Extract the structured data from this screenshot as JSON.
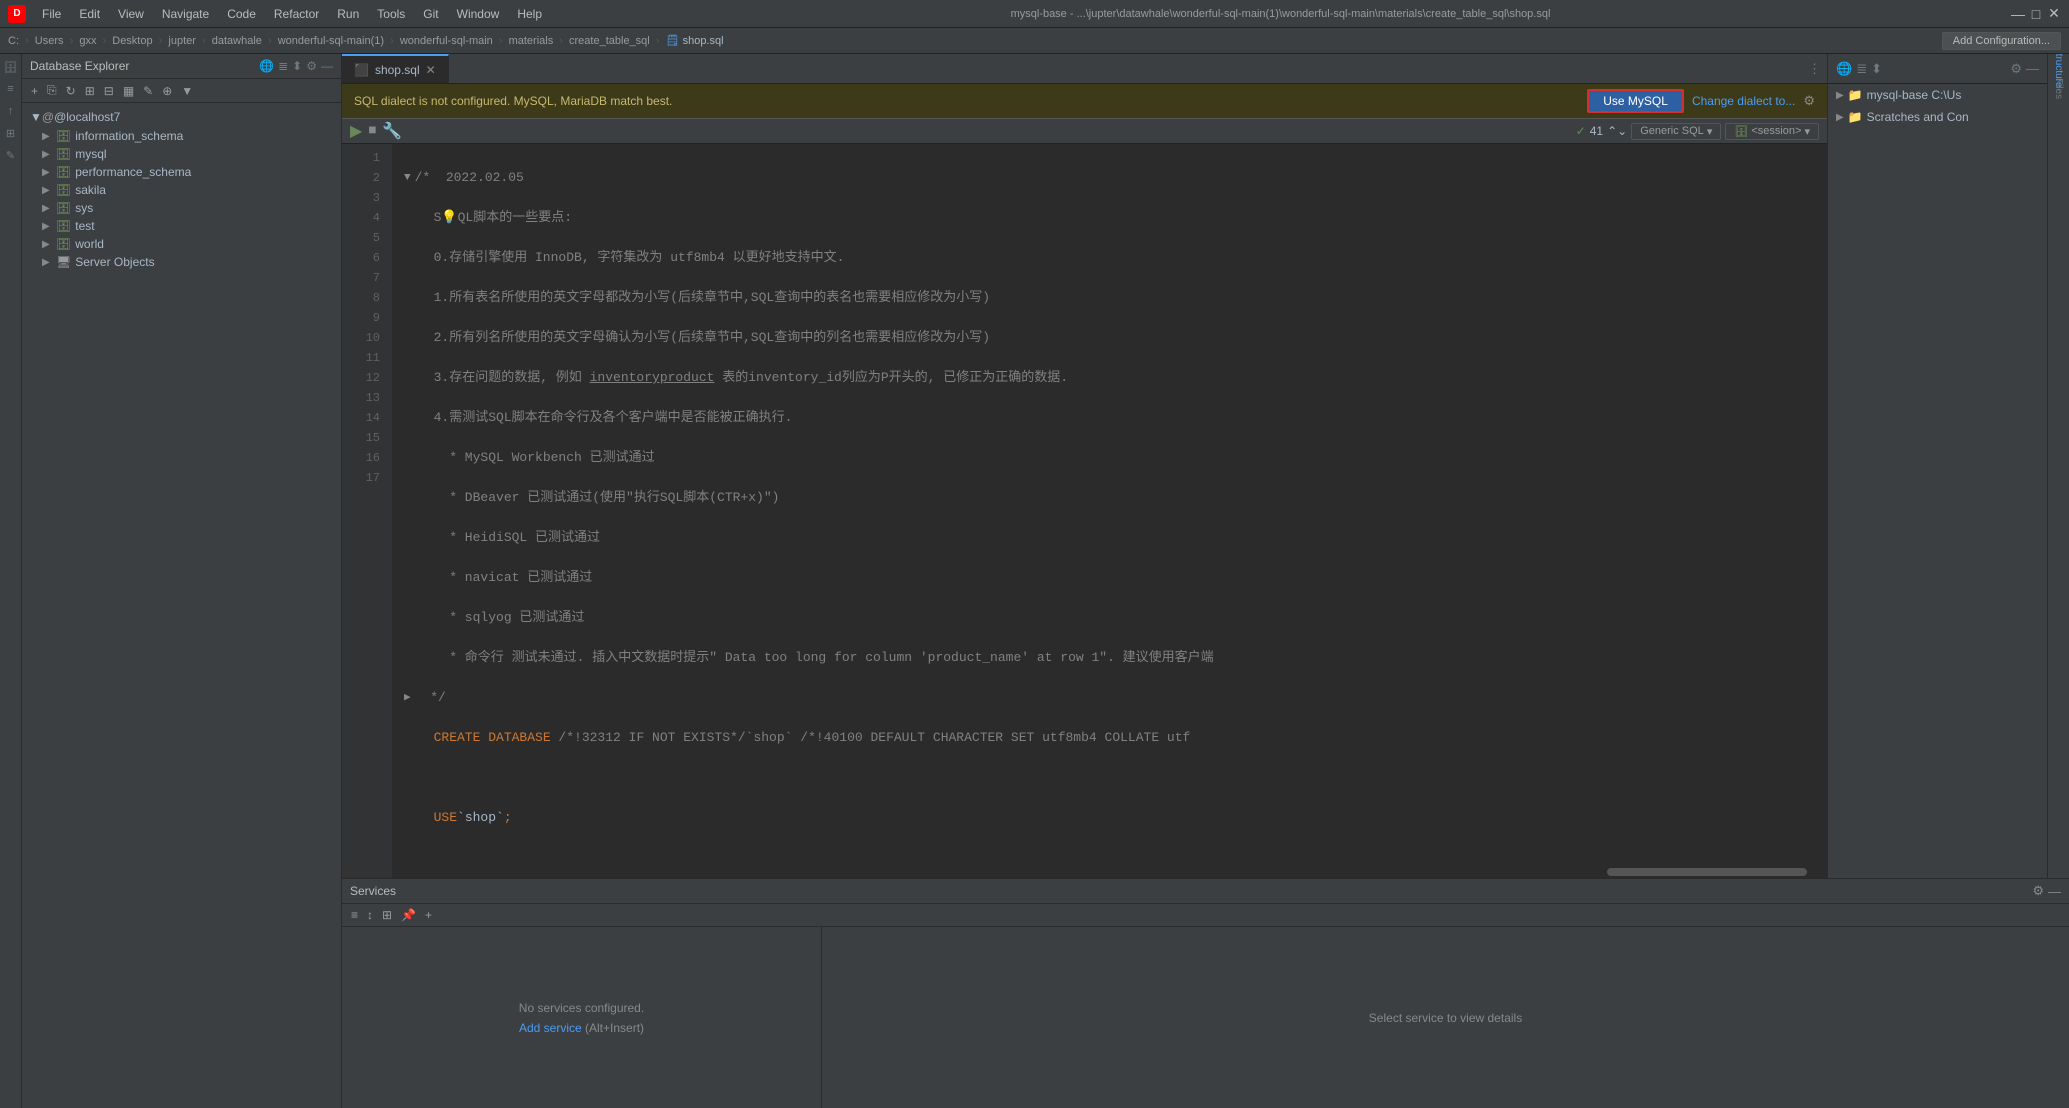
{
  "titlebar": {
    "logo": "D",
    "menus": [
      "File",
      "Edit",
      "View",
      "Navigate",
      "Code",
      "Refactor",
      "Run",
      "Tools",
      "Git",
      "Window",
      "Help"
    ],
    "path": "mysql-base - ...\\jupter\\datawhale\\wonderful-sql-main(1)\\wonderful-sql-main\\materials\\create_table_sql\\shop.sql",
    "controls": [
      "—",
      "□",
      "✕"
    ]
  },
  "breadcrumb": {
    "items": [
      "C:",
      "Users",
      "gxx",
      "Desktop",
      "jupter",
      "datawhale",
      "wonderful-sql-main(1)",
      "wonderful-sql-main",
      "materials",
      "create_table_sql"
    ],
    "file": "shop.sql",
    "add_config": "Add Configuration..."
  },
  "db_explorer": {
    "title": "Database Explorer",
    "root": "@localhost",
    "badge": "7",
    "items": [
      {
        "name": "information_schema",
        "type": "schema",
        "expanded": false
      },
      {
        "name": "mysql",
        "type": "schema",
        "expanded": false
      },
      {
        "name": "performance_schema",
        "type": "schema",
        "expanded": false
      },
      {
        "name": "sakila",
        "type": "schema",
        "expanded": false
      },
      {
        "name": "sys",
        "type": "schema",
        "expanded": false
      },
      {
        "name": "test",
        "type": "schema",
        "expanded": false
      },
      {
        "name": "world",
        "type": "schema",
        "expanded": false
      },
      {
        "name": "Server Objects",
        "type": "server",
        "expanded": false
      }
    ]
  },
  "editor": {
    "tab_name": "shop.sql",
    "sql_banner": {
      "text": "SQL dialect is not configured. MySQL, MariaDB match best.",
      "use_mysql": "Use MySQL",
      "change_dialect": "Change dialect to...",
      "has_gear": true
    },
    "dialect": "Generic SQL",
    "session": "<session>",
    "check_count": "41",
    "lines": [
      {
        "num": "1",
        "content": "/*  2022.02.05",
        "fold": true
      },
      {
        "num": "2",
        "content": "  SQL脚本的一些要点:"
      },
      {
        "num": "3",
        "content": "  0.存储引擎使用 InnoDB, 字符集改为 utf8mb4 以更好地支持中文."
      },
      {
        "num": "4",
        "content": "  1.所有表名所使用的英文字母都改为小写(后续章节中,SQL查询中的表名也需要相应修改为小写)"
      },
      {
        "num": "5",
        "content": "  2.所有列名所使用的英文字母确认为小写(后续章节中,SQL查询中的列名也需要相应修改为小写)"
      },
      {
        "num": "6",
        "content": "  3.存在问题的数据, 例如 inventoryproduct 表的inventory_id列应为P开头的, 已修正为正确的数据."
      },
      {
        "num": "7",
        "content": "  4.需测试SQL脚本在命令行及各个客户端中是否能被正确执行."
      },
      {
        "num": "8",
        "content": "    * MySQL Workbench 已测试通过"
      },
      {
        "num": "9",
        "content": "    * DBeaver 已测试通过(使用\"执行SQL脚本(CTR+x)\")"
      },
      {
        "num": "10",
        "content": "    * HeidiSQL 已测试通过"
      },
      {
        "num": "11",
        "content": "    * navicat 已测试通过"
      },
      {
        "num": "12",
        "content": "    * sqlyog 已测试通过"
      },
      {
        "num": "13",
        "content": "    * 命令行 测试未通过. 插入中文数据时提示\" Data too long for column 'product_name' at row 1\". 建议使用客户端"
      },
      {
        "num": "14",
        "content": "  */",
        "fold": true
      },
      {
        "num": "15",
        "content": "  CREATE DATABASE /*!32312 IF NOT EXISTS*/`shop` /*!40100 DEFAULT CHARACTER SET utf8mb4 COLLATE utf"
      },
      {
        "num": "16",
        "content": ""
      },
      {
        "num": "17",
        "content": "  USE `shop`;"
      }
    ]
  },
  "right_sidebar": {
    "items": [
      {
        "label": "mysql-base  C:\\Us",
        "expanded": false
      },
      {
        "label": "Scratches and Con",
        "expanded": false
      }
    ]
  },
  "services": {
    "title": "Services",
    "empty_text": "No services configured.",
    "add_link": "Add service",
    "add_shortcut": "(Alt+Insert)",
    "select_text": "Select service to view details"
  }
}
